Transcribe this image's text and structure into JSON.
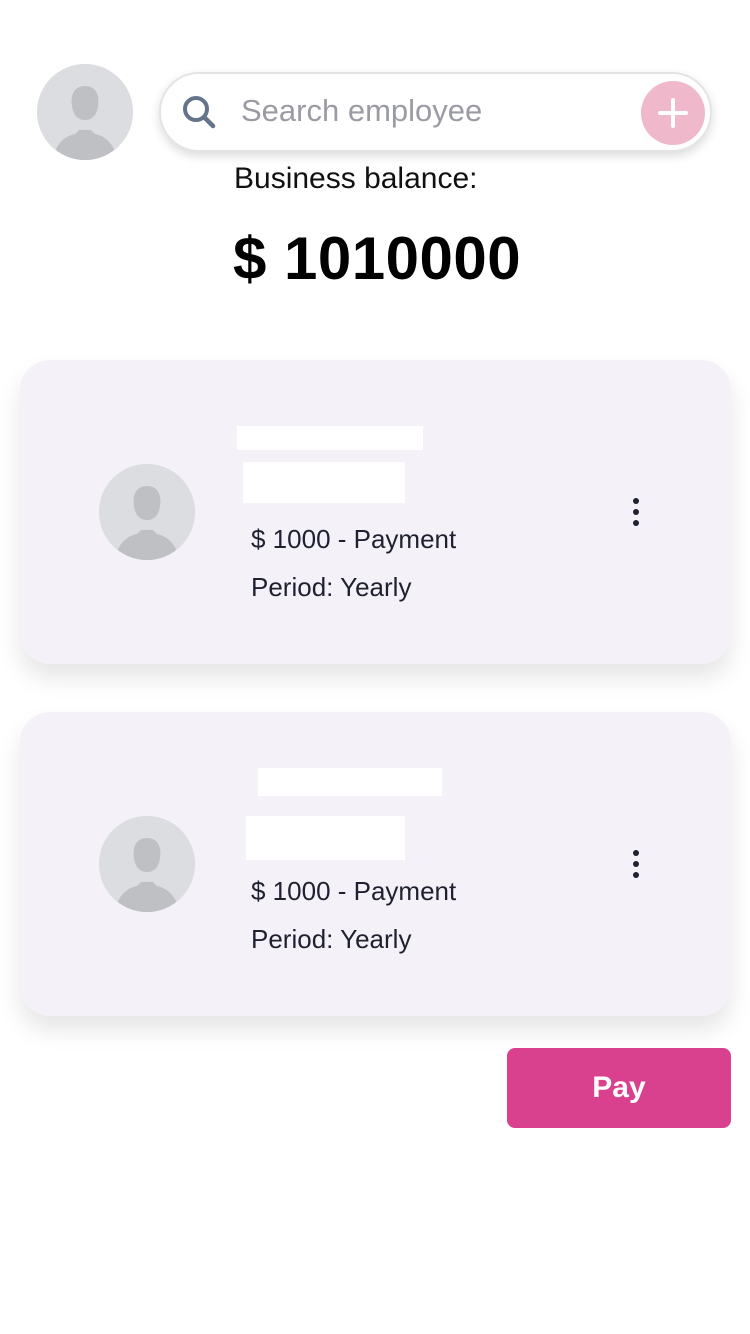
{
  "header": {
    "search": {
      "placeholder": "Search employee",
      "value": ""
    },
    "add_button_icon": "plus-icon",
    "search_icon": "search-icon",
    "avatar_icon": "user-silhouette-icon"
  },
  "balance": {
    "label": "Business balance:",
    "amount": "$ 1010000"
  },
  "employees": [
    {
      "name": "",
      "payment": "$ 1000 - Payment",
      "period": "Period: Yearly",
      "menu_icon": "more-vertical-icon"
    },
    {
      "name": "",
      "payment": "$ 1000 - Payment",
      "period": "Period: Yearly",
      "menu_icon": "more-vertical-icon"
    }
  ],
  "actions": {
    "pay_label": "Pay"
  },
  "colors": {
    "accent": "#d9408e",
    "add_button": "#efb8cb",
    "card_background": "#f5f1f8"
  }
}
